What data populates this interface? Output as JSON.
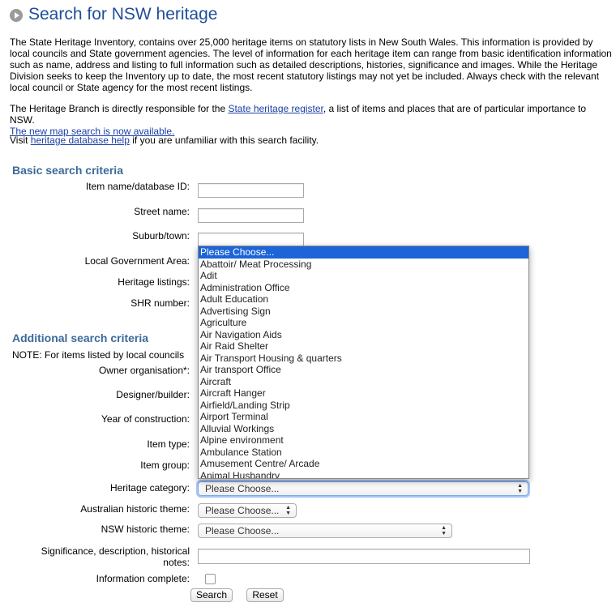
{
  "page_title": "Search for NSW heritage",
  "intro_paragraph": "The State Heritage Inventory, contains over 25,000 heritage items on statutory lists in New South Wales. This information is provided by local councils and State government agencies. The level of information for each heritage item can range from basic identification information such as name, address and listing to full information such as detailed descriptions, histories, significance and images. While the Heritage Division seeks to keep the Inventory up to date, the most recent statutory listings may not yet be included. Always check with the relevant local council or State agency for the most recent listings.",
  "branch_text_before": "The Heritage Branch is directly responsible for the ",
  "branch_link": "State heritage register",
  "branch_text_after": ", a list of items and places that are of particular importance to NSW.",
  "map_link": "The new map search is now available.",
  "visit_before": "Visit ",
  "help_link": "heritage database help",
  "visit_after": " if you are unfamiliar with this search facility.",
  "basic": {
    "title": "Basic search criteria",
    "item_name_label": "Item name/database ID:",
    "street_label": "Street name:",
    "suburb_label": "Suburb/town:",
    "lga_label": "Local Government Area:",
    "listings_label": "Heritage listings:",
    "shr_label": "SHR number:"
  },
  "additional": {
    "title": "Additional search criteria",
    "note": "NOTE: For items listed by local councils",
    "owner_label": "Owner organisation*:",
    "designer_label": "Designer/builder:",
    "year_label": "Year of construction:",
    "item_type_label": "Item type:",
    "item_group_label": "Item group:",
    "category_label": "Heritage category:",
    "category_value": "Please Choose...",
    "aus_theme_label": "Australian historic theme:",
    "aus_theme_value": "Please Choose...",
    "nsw_theme_label": "NSW historic theme:",
    "nsw_theme_value": "Please Choose...",
    "significance_label_line1": "Significance, description, historical",
    "significance_label_line2": "notes:",
    "info_complete_label": "Information complete:"
  },
  "buttons": {
    "search": "Search",
    "reset": "Reset"
  },
  "dropdown_options": [
    "Please Choose...",
    "Abattoir/ Meat Processing",
    "Adit",
    "Administration Office",
    "Adult Education",
    "Advertising Sign",
    "Agriculture",
    "Air Navigation Aids",
    "Air Raid Shelter",
    "Air Transport Housing & quarters",
    "Air transport Office",
    "Aircraft",
    "Aircraft Hanger",
    "Airfield/Landing Strip",
    "Airport Terminal",
    "Alluvial Workings",
    "Alpine environment",
    "Ambulance Station",
    "Amusement Centre/ Arcade",
    "Animal Husbandry"
  ],
  "colors": {
    "title": "#1f4e9b",
    "section": "#3d6a9a",
    "link": "#1a3fa5",
    "selected": "#1c64d8"
  }
}
